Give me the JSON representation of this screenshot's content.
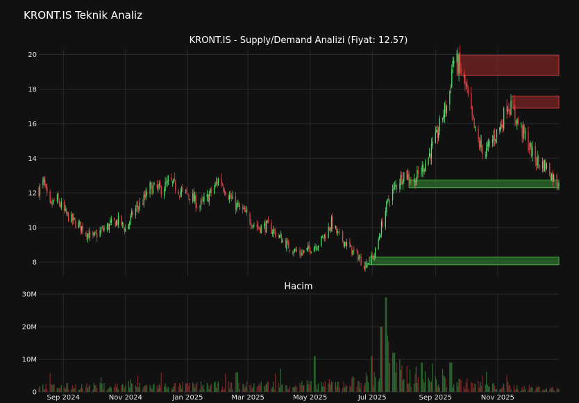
{
  "app": {
    "title": "KRONT.IS Teknik Analiz"
  },
  "colors": {
    "background": "#111111",
    "grid": "#2a2a30",
    "up": "#55e06a",
    "down": "#e04848",
    "supply_fill": "#7a2424",
    "supply_stroke": "#c03a3a",
    "demand_fill": "#2c6a2c",
    "demand_stroke": "#4aa84a"
  },
  "chart_data": [
    {
      "type": "candlestick",
      "title": "KRONT.IS - Supply/Demand Analizi (Fiyat: 12.57)",
      "ylim": [
        7.2,
        20.3
      ],
      "yticks": [
        8,
        10,
        12,
        14,
        16,
        18,
        20
      ],
      "x_range": [
        "2024-08-08",
        "2025-12-31"
      ],
      "grid": true,
      "price_path": [
        [
          "2024-08-08",
          12.2
        ],
        [
          "2024-08-13",
          12.6
        ],
        [
          "2024-08-18",
          11.1
        ],
        [
          "2024-08-25",
          11.7
        ],
        [
          "2024-09-03",
          10.8
        ],
        [
          "2024-09-10",
          10.4
        ],
        [
          "2024-09-17",
          10.1
        ],
        [
          "2024-09-24",
          9.7
        ],
        [
          "2024-09-30",
          9.4
        ],
        [
          "2024-10-08",
          9.8
        ],
        [
          "2024-10-18",
          10.2
        ],
        [
          "2024-10-25",
          10.4
        ],
        [
          "2024-11-01",
          9.9
        ],
        [
          "2024-11-10",
          11.0
        ],
        [
          "2024-11-18",
          11.5
        ],
        [
          "2024-11-25",
          12.3
        ],
        [
          "2024-12-05",
          12.2
        ],
        [
          "2024-12-15",
          12.6
        ],
        [
          "2024-12-25",
          12.1
        ],
        [
          "2025-01-05",
          11.8
        ],
        [
          "2025-01-12",
          11.2
        ],
        [
          "2025-01-20",
          11.7
        ],
        [
          "2025-01-27",
          12.3
        ],
        [
          "2025-02-01",
          12.9
        ],
        [
          "2025-02-05",
          12.4
        ],
        [
          "2025-02-15",
          11.4
        ],
        [
          "2025-02-25",
          10.9
        ],
        [
          "2025-03-05",
          10.3
        ],
        [
          "2025-03-12",
          10.0
        ],
        [
          "2025-03-20",
          10.1
        ],
        [
          "2025-03-28",
          9.7
        ],
        [
          "2025-04-05",
          9.2
        ],
        [
          "2025-04-12",
          8.8
        ],
        [
          "2025-04-22",
          8.5
        ],
        [
          "2025-05-01",
          8.8
        ],
        [
          "2025-05-10",
          9.1
        ],
        [
          "2025-05-18",
          9.8
        ],
        [
          "2025-05-22",
          10.3
        ],
        [
          "2025-05-28",
          9.6
        ],
        [
          "2025-06-05",
          9.1
        ],
        [
          "2025-06-12",
          8.6
        ],
        [
          "2025-06-18",
          8.3
        ],
        [
          "2025-06-22",
          7.8
        ],
        [
          "2025-06-28",
          8.1
        ],
        [
          "2025-07-03",
          8.4
        ],
        [
          "2025-07-07",
          9.3
        ],
        [
          "2025-07-12",
          10.6
        ],
        [
          "2025-07-18",
          11.8
        ],
        [
          "2025-07-25",
          12.5
        ],
        [
          "2025-08-02",
          13.2
        ],
        [
          "2025-08-10",
          12.6
        ],
        [
          "2025-08-18",
          13.3
        ],
        [
          "2025-08-25",
          14.1
        ],
        [
          "2025-09-02",
          15.2
        ],
        [
          "2025-09-08",
          16.5
        ],
        [
          "2025-09-14",
          17.3
        ],
        [
          "2025-09-18",
          19.7
        ],
        [
          "2025-09-24",
          19.4
        ],
        [
          "2025-10-01",
          18.0
        ],
        [
          "2025-10-07",
          16.2
        ],
        [
          "2025-10-12",
          15.0
        ],
        [
          "2025-10-20",
          14.3
        ],
        [
          "2025-10-28",
          15.2
        ],
        [
          "2025-11-05",
          16.0
        ],
        [
          "2025-11-10",
          17.2
        ],
        [
          "2025-11-15",
          16.8
        ],
        [
          "2025-11-22",
          15.9
        ],
        [
          "2025-11-30",
          15.0
        ],
        [
          "2025-12-06",
          14.1
        ],
        [
          "2025-12-12",
          13.7
        ],
        [
          "2025-12-18",
          13.6
        ],
        [
          "2025-12-24",
          13.0
        ],
        [
          "2025-12-30",
          12.57
        ]
      ],
      "zones": [
        {
          "kind": "supply",
          "start": "2025-09-22",
          "end": "2025-12-31",
          "low": 18.8,
          "high": 19.95
        },
        {
          "kind": "supply",
          "start": "2025-11-15",
          "end": "2025-12-31",
          "low": 16.9,
          "high": 17.6
        },
        {
          "kind": "demand",
          "start": "2025-08-06",
          "end": "2025-12-31",
          "low": 12.3,
          "high": 12.75
        },
        {
          "kind": "demand",
          "start": "2025-06-28",
          "end": "2025-12-31",
          "low": 7.85,
          "high": 8.3
        }
      ]
    },
    {
      "type": "bar",
      "title": "Hacim",
      "ylim": [
        0,
        30000000
      ],
      "yticks": [
        0,
        10000000,
        20000000,
        30000000
      ],
      "ytick_labels": [
        "0",
        "10M",
        "20M",
        "30M"
      ],
      "volume_profile": [
        [
          "2024-08-08",
          2000000
        ],
        [
          "2024-11-15",
          2200000
        ],
        [
          "2025-03-01",
          2500000
        ],
        [
          "2025-06-01",
          3000000
        ],
        [
          "2025-07-01",
          5000000
        ],
        [
          "2025-07-15",
          9000000
        ],
        [
          "2025-08-01",
          7000000
        ],
        [
          "2025-09-01",
          4000000
        ],
        [
          "2025-10-01",
          3200000
        ],
        [
          "2025-11-01",
          2000000
        ],
        [
          "2025-12-31",
          1200000
        ]
      ],
      "spikes": [
        [
          "2025-05-05",
          11000000
        ],
        [
          "2025-06-30",
          11000000
        ],
        [
          "2025-07-10",
          20000000
        ],
        [
          "2025-07-14",
          29000000
        ],
        [
          "2025-07-22",
          12000000
        ],
        [
          "2025-08-18",
          9000000
        ],
        [
          "2025-09-16",
          9000000
        ],
        [
          "2025-02-18",
          6000000
        ]
      ]
    }
  ],
  "x_axis": {
    "ticks": [
      {
        "date": "2024-09-01",
        "label": "Sep 2024"
      },
      {
        "date": "2024-11-01",
        "label": "Nov 2024"
      },
      {
        "date": "2025-01-01",
        "label": "Jan 2025"
      },
      {
        "date": "2025-03-01",
        "label": "Mar 2025"
      },
      {
        "date": "2025-05-01",
        "label": "May 2025"
      },
      {
        "date": "2025-07-01",
        "label": "Jul 2025"
      },
      {
        "date": "2025-09-01",
        "label": "Sep 2025"
      },
      {
        "date": "2025-11-01",
        "label": "Nov 2025"
      }
    ]
  }
}
